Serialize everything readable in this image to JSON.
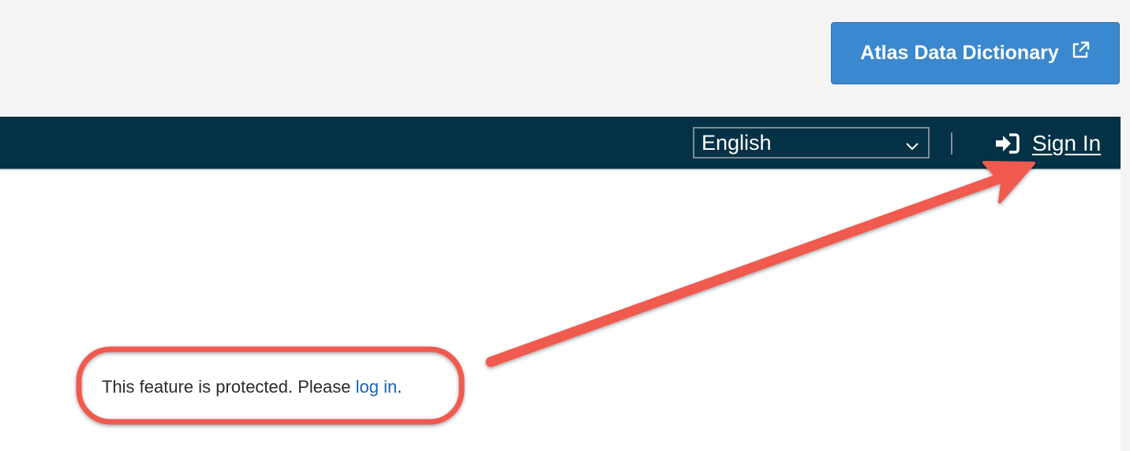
{
  "header": {
    "dictionary_button_label": "Atlas Data Dictionary",
    "dictionary_button_icon": "external-link-icon",
    "accent_color": "#3a88cf"
  },
  "navbar": {
    "background_color": "#043145",
    "language_select": {
      "selected": "English",
      "icon": "chevron-down-icon"
    },
    "signin": {
      "label": "Sign In",
      "icon": "sign-in-icon"
    }
  },
  "content": {
    "notice_text": "This feature is protected. Please ",
    "notice_link": "log in",
    "notice_end": "."
  },
  "annotations": {
    "color": "#f05a4f",
    "highlight_shape": "rounded-rectangle",
    "arrow_icon": "arrow-icon"
  }
}
